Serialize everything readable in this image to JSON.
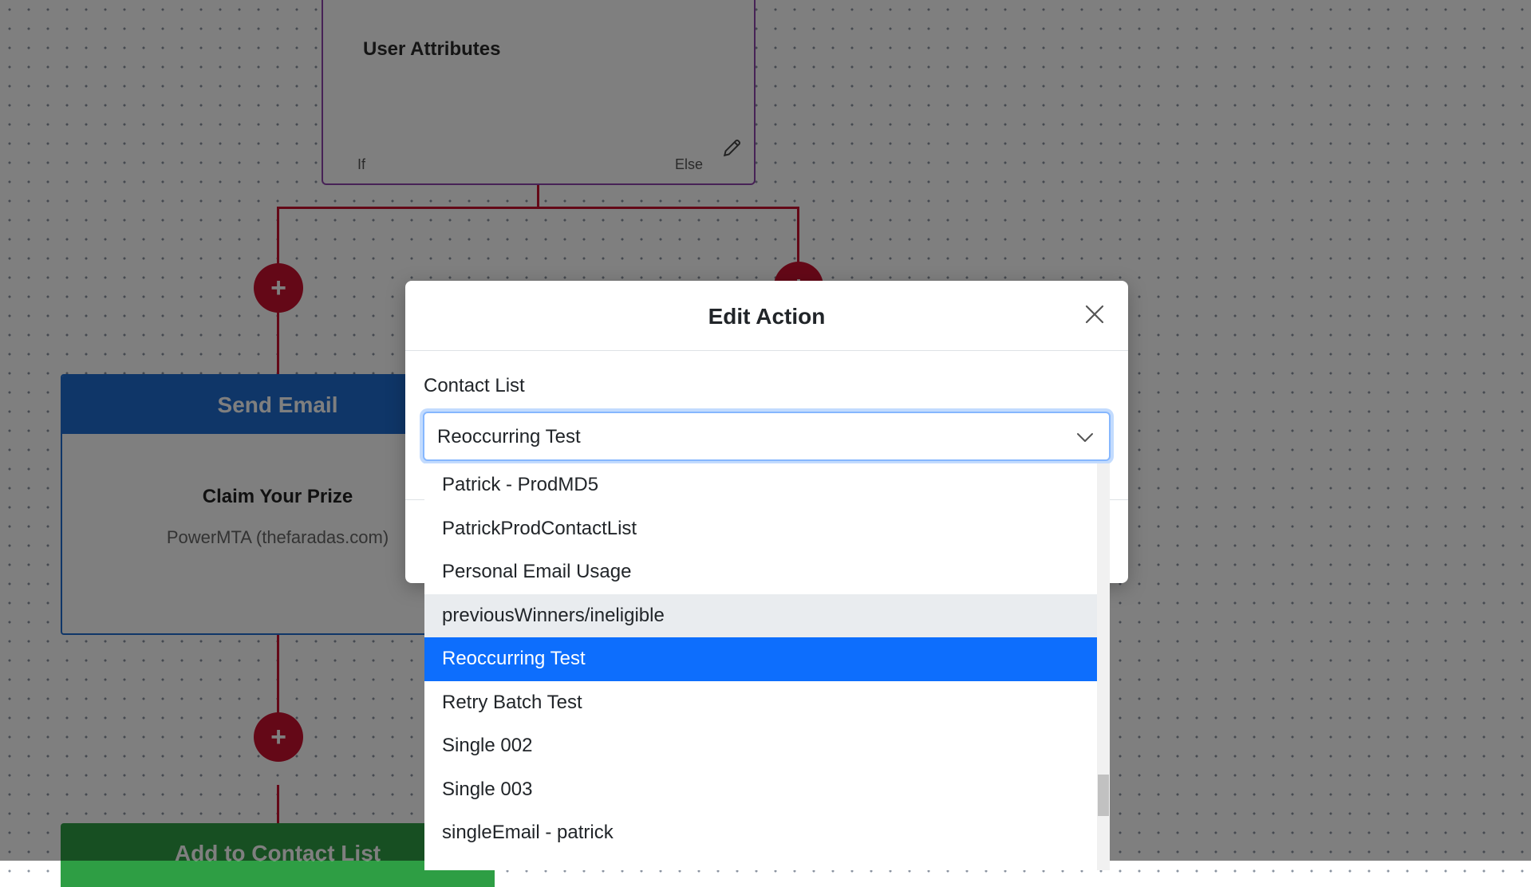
{
  "canvas": {
    "condition_node": {
      "title": "User Attributes",
      "if_label": "If",
      "else_label": "Else"
    },
    "email_node": {
      "header": "Send Email",
      "subject": "Claim Your Prize",
      "sender": "PowerMTA (thefaradas.com)"
    },
    "add_list_node": {
      "header": "Add to Contact List"
    },
    "plus_symbol": "+"
  },
  "modal": {
    "title": "Edit Action",
    "field_label": "Contact List",
    "selected_value": "Reoccurring Test"
  },
  "dropdown": {
    "options": [
      "Patrick - ProdMD5",
      "PatrickProdContactList",
      "Personal Email Usage",
      "previousWinners/ineligible",
      "Reoccurring Test",
      "Retry Batch Test",
      "Single 002",
      "Single 003",
      "singleEmail - patrick"
    ],
    "hovered_option": "previousWinners/ineligible",
    "selected_option": "Reoccurring Test"
  },
  "colors": {
    "connector": "#c8102e",
    "email_header": "#1f6dd1",
    "add_list_header": "#2e9e44",
    "condition_border": "#8e44ad",
    "selected_option": "#0d6efd"
  }
}
